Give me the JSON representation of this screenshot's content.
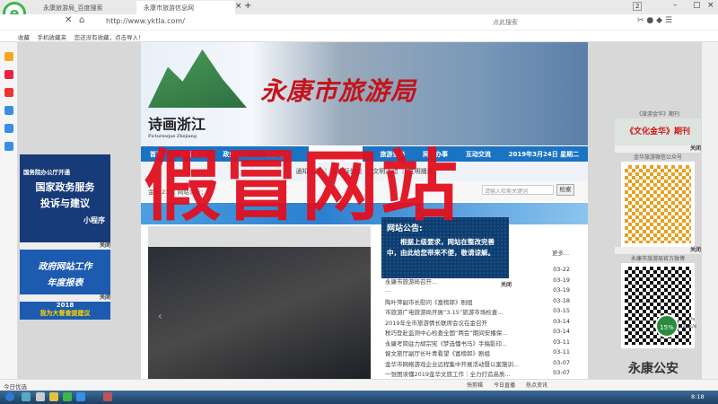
{
  "browser": {
    "tabs": [
      "永康旅游局_百度搜索",
      "永康市旅游信息网"
    ],
    "url": "http://www.yktla.com/",
    "search_placeholder": "点此搜索",
    "bookmarks": [
      "收藏",
      "手机收藏夹",
      "您还没有收藏，点击导入！"
    ],
    "tab_count": "2"
  },
  "site": {
    "banner_title": "永康市旅游局",
    "logo_text": "诗画浙江",
    "logo_sub": "Picturesque Zhejiang",
    "nav": [
      "首页",
      "本局概况",
      "政务公开",
      "工作动态",
      "",
      "旅游业务",
      "网上办事",
      "互动交流",
      "2019年3月24日 星期二"
    ],
    "subnav": "通知公告 ｜ 招投标信息 ｜ 文明活动 ｜ 文明播报",
    "info_row": "金华 23℃ 网站公告：...",
    "search_placeholder": "请输入检索关键词",
    "search_button": "检索",
    "notice": {
      "title": "网站公告:",
      "body": "根据上级要求，网站在整改完善中，由此给您带来不便，敬请谅解。",
      "close": "关闭"
    },
    "more": "更多...",
    "news": [
      {
        "title": "金华市旅游局关于发布...",
        "date": "03-22"
      },
      {
        "title": "永康市旅游局召开...",
        "date": "03-19"
      },
      {
        "title": "...",
        "date": "03-19"
      },
      {
        "title": "陶叶萍副市长慰问《富榜郎》剧组",
        "date": "03-18"
      },
      {
        "title": "市旅游广电旅游局开展“3.15”旅游市场检查...",
        "date": "03-15"
      },
      {
        "title": "2019年全市旅游情长联席会议在金召开",
        "date": "03-14"
      },
      {
        "title": "税巧登赴监测中心检查全国“两会”期间安播保...",
        "date": "03-14"
      },
      {
        "title": "永康考简驻力胡宗宪《梦选懂书马》手稿影印...",
        "date": "03-11"
      },
      {
        "title": "督文旅厅副厅长叶青看望《富榜郎》剧组",
        "date": "03-11"
      },
      {
        "title": "金华市网络游戏企业远程集中开展活动暨以案施训...",
        "date": "03-07"
      },
      {
        "title": "一张图读懂2019金华文旅工作｜全力打造高质...",
        "date": "03-07"
      }
    ]
  },
  "left_ads": [
    {
      "line1": "国务院办公厅开通",
      "line2": "国家政务服务",
      "line3": "投诉与建议",
      "line4": "小程序"
    },
    {
      "line1": "政府网站工作",
      "line2": "年度报表"
    },
    {
      "line1": "2018",
      "line2": "我为大督查提建议"
    }
  ],
  "ad_close": "关闭",
  "right_ads": {
    "caption1": "《旅游金华》期刊",
    "banner": "《文化金华》期刊",
    "caption2": "金华旅游微信公众号",
    "caption3": "永康市旅游局官方微博"
  },
  "overlay": {
    "fake_text": "假冒网站",
    "watermark": "永康公安"
  },
  "speed": {
    "percent": "15%",
    "up": "0.7K/s",
    "down": "123K/s"
  },
  "status": {
    "left": "今日优选",
    "right": [
      "快剪辑",
      "今日直播",
      "热点资讯"
    ]
  },
  "taskbar": {
    "time": "8:18"
  }
}
